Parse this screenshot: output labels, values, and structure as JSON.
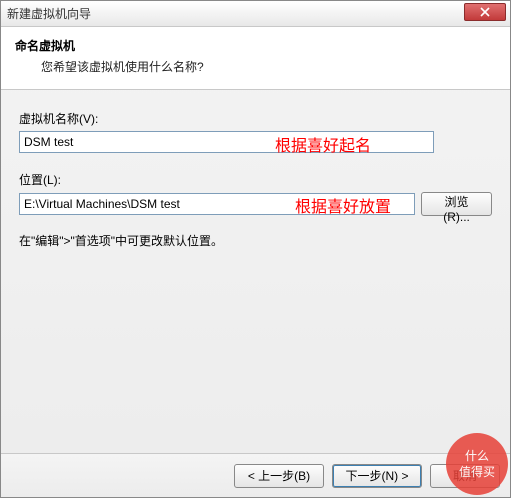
{
  "window": {
    "title": "新建虚拟机向导"
  },
  "header": {
    "title": "命名虚拟机",
    "subtitle": "您希望该虚拟机使用什么名称?"
  },
  "fields": {
    "name_label": "虚拟机名称(V):",
    "name_value": "DSM test",
    "location_label": "位置(L):",
    "location_value": "E:\\Virtual Machines\\DSM test",
    "browse_label": "浏览(R)..."
  },
  "hint": "在\"编辑\">\"首选项\"中可更改默认位置。",
  "annotations": {
    "name_note": "根据喜好起名",
    "location_note": "根据喜好放置"
  },
  "footer": {
    "back": "< 上一步(B)",
    "next": "下一步(N) >",
    "cancel": "取消"
  },
  "watermark": "什么值得买"
}
